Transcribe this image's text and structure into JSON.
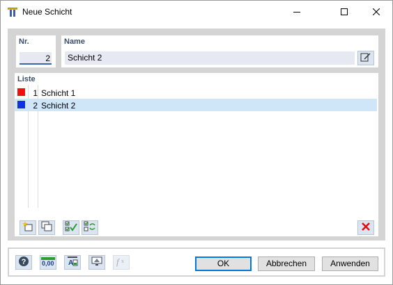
{
  "window": {
    "title": "Neue Schicht"
  },
  "number": {
    "label": "Nr.",
    "value": "2"
  },
  "name": {
    "label": "Name",
    "value": "Schicht 2"
  },
  "list": {
    "label": "Liste",
    "items": [
      {
        "num": "1",
        "name": "Schicht 1",
        "color": "#ee1111"
      },
      {
        "num": "2",
        "name": "Schicht 2",
        "color": "#1133dd"
      }
    ],
    "selected_index": 1
  },
  "buttons": {
    "ok": "OK",
    "cancel": "Abbrechen",
    "apply": "Anwenden"
  },
  "units_icon_text": "0,00",
  "icons": {
    "app": "layer-app-icon",
    "minimize": "minimize-icon",
    "maximize": "maximize-icon",
    "close": "close-icon",
    "edit": "edit-icon",
    "list_tools": [
      "new-item-icon",
      "copy-item-icon",
      "check-all-icon",
      "check-invert-icon",
      "delete-icon"
    ],
    "footer_tools": [
      "help-icon",
      "units-icon",
      "text-format-icon",
      "view-icon",
      "function-icon"
    ]
  }
}
